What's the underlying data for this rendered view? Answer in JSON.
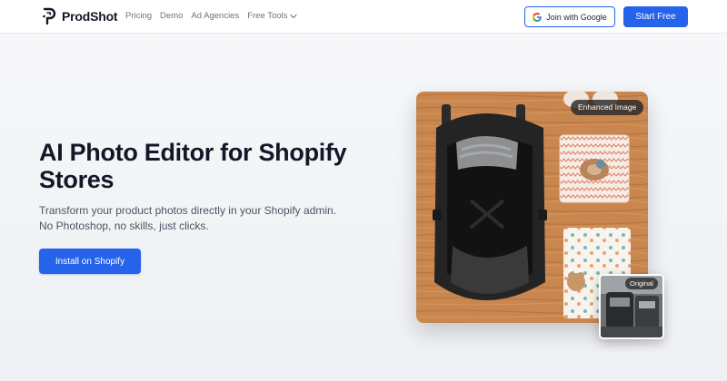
{
  "header": {
    "brand": "ProdShot",
    "nav": [
      {
        "label": "Pricing"
      },
      {
        "label": "Demo"
      },
      {
        "label": "Ad Agencies"
      },
      {
        "label": "Free Tools",
        "icon": "chevron-down-icon"
      }
    ],
    "google_button": {
      "label": "Join with Google",
      "icon": "google-icon"
    },
    "start_button": "Start Free"
  },
  "hero": {
    "title": "AI Photo Editor for Shopify Stores",
    "subtitle": "Transform your product photos directly in your Shopify admin. No Photoshop, no skills, just clicks.",
    "cta": "Install on Shopify"
  },
  "images": {
    "enhanced_badge": "Enhanced Image",
    "original_badge": "Original"
  },
  "colors": {
    "accent": "#2563eb",
    "text": "#111827",
    "muted": "#4b5563"
  }
}
